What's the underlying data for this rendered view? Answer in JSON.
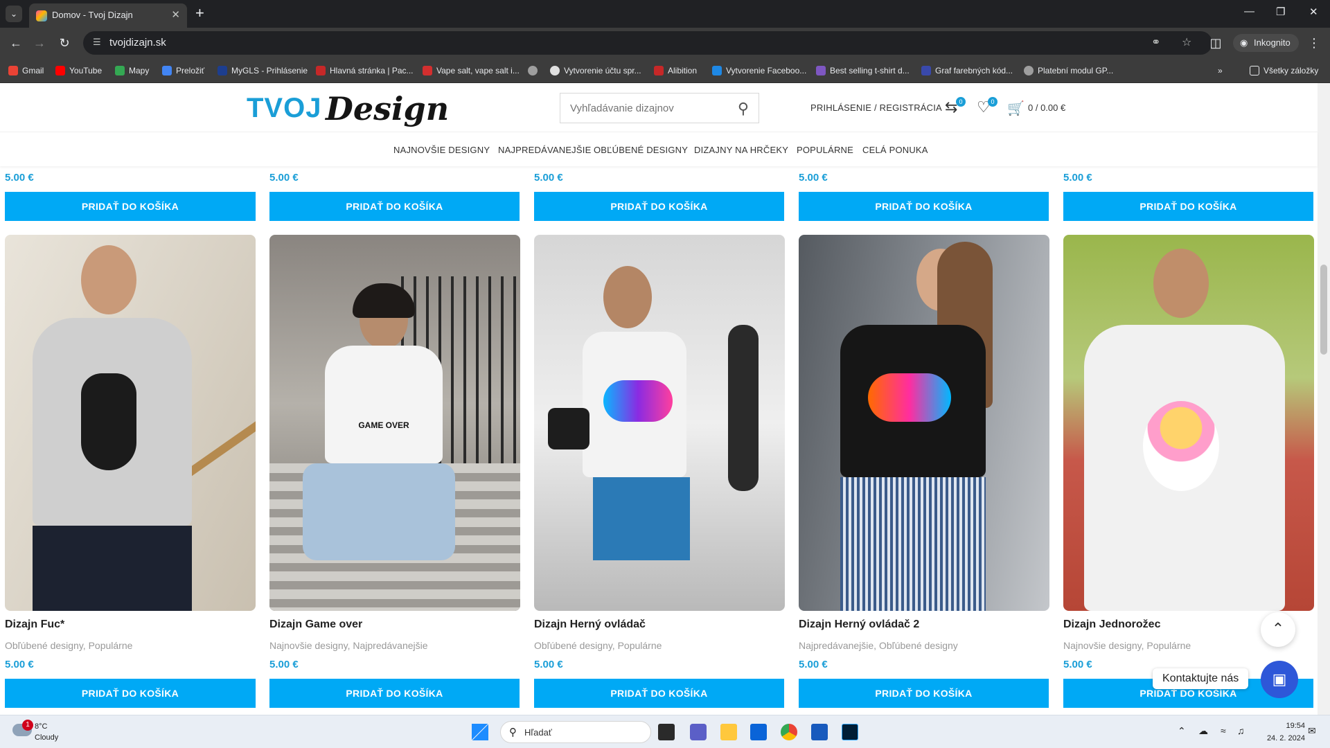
{
  "browser": {
    "tab_title": "Domov - Tvoj Dizajn",
    "url": "tvojdizajn.sk",
    "incognito_label": "Inkognito",
    "bookmarks": [
      {
        "label": "Gmail",
        "color": "#ea4335"
      },
      {
        "label": "YouTube",
        "color": "#ff0000"
      },
      {
        "label": "Mapy",
        "color": "#34a853"
      },
      {
        "label": "Preložiť",
        "color": "#4285f4"
      },
      {
        "label": "MyGLS - Prihlásenie",
        "color": "#1d3e8f"
      },
      {
        "label": "Hlavná stránka | Pac...",
        "color": "#c62828"
      },
      {
        "label": "Vape salt, vape salt i...",
        "color": "#d32f2f"
      },
      {
        "label": "",
        "color": "#9e9e9e"
      },
      {
        "label": "Vytvorenie účtu spr...",
        "color": "#e0e0e0"
      },
      {
        "label": "Alibition",
        "color": "#c62828"
      },
      {
        "label": "Vytvorenie Faceboo...",
        "color": "#1e88e5"
      },
      {
        "label": "Best selling t-shirt d...",
        "color": "#7e57c2"
      },
      {
        "label": "Graf farebných kód...",
        "color": "#3949ab"
      },
      {
        "label": "Platební modul GP...",
        "color": "#9e9e9e"
      }
    ],
    "all_bookmarks_label": "Všetky záložky"
  },
  "site": {
    "logo_part1": "TVOJ",
    "logo_part2": "Design",
    "search_placeholder": "Vyhľadávanie dizajnov",
    "login_label": "PRIHLÁSENIE / REGISTRÁCIA",
    "compare_count": "0",
    "wishlist_count": "0",
    "cart_total": "0 / 0.00 €",
    "accent_color": "#00a9f5",
    "nav": [
      "NAJNOVŠIE DESIGNY",
      "NAJPREDÁVANEJŠIE",
      "OBĽÚBENÉ DESIGNY",
      "DIZAJNY NA HRČEKY",
      "POPULÁRNE",
      "CELÁ PONUKA"
    ]
  },
  "top_row": [
    {
      "price": "5.00 €",
      "button": "PRIDAŤ DO KOŠÍKA"
    },
    {
      "price": "5.00 €",
      "button": "PRIDAŤ DO KOŠÍKA"
    },
    {
      "price": "5.00 €",
      "button": "PRIDAŤ DO KOŠÍKA"
    },
    {
      "price": "5.00 €",
      "button": "PRIDAŤ DO KOŠÍKA"
    },
    {
      "price": "5.00 €",
      "button": "PRIDAŤ DO KOŠÍKA"
    }
  ],
  "products": [
    {
      "name": "Dizajn Fuc*",
      "categories": "Obľúbené designy, Populárne",
      "price": "5.00 €",
      "button": "PRIDAŤ DO KOŠÍKA"
    },
    {
      "name": "Dizajn Game over",
      "categories": "Najnovšie designy, Najpredávanejšie",
      "price": "5.00 €",
      "button": "PRIDAŤ DO KOŠÍKA",
      "shirt_text": "GAME OVER"
    },
    {
      "name": "Dizajn Herný ovládač",
      "categories": "Obľúbené designy, Populárne",
      "price": "5.00 €",
      "button": "PRIDAŤ DO KOŠÍKA"
    },
    {
      "name": "Dizajn Herný ovládač 2",
      "categories": "Najpredávanejšie, Obľúbené designy",
      "price": "5.00 €",
      "button": "PRIDAŤ DO KOŠÍKA"
    },
    {
      "name": "Dizajn Jednorožec",
      "categories": "Najnovšie designy, Populárne",
      "price": "5.00 €",
      "button": "PRIDAŤ DO KOŠÍKA"
    }
  ],
  "widgets": {
    "contact_label": "Kontaktujte nás"
  },
  "taskbar": {
    "weather_temp": "8°C",
    "weather_desc": "Cloudy",
    "weather_badge": "1",
    "search_label": "Hľadať",
    "time": "19:54",
    "date": "24. 2. 2024"
  }
}
